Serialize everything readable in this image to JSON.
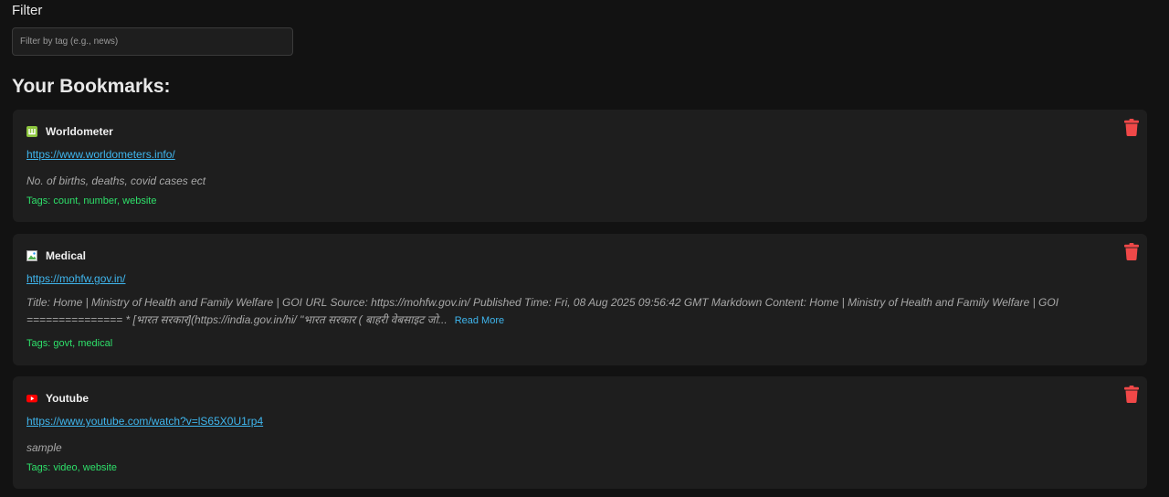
{
  "filter": {
    "label": "Filter",
    "placeholder": "Filter by tag (e.g., news)",
    "value": ""
  },
  "section_title": "Your Bookmarks:",
  "colors": {
    "background": "#121212",
    "card": "#1e1e1e",
    "link": "#3fb6ee",
    "tags": "#2ee06a",
    "delete": "#f04848"
  },
  "bookmarks": [
    {
      "icon": "worldometer-favicon",
      "title": "Worldometer",
      "url": "https://www.worldometers.info/",
      "description": "No. of births, deaths, covid cases ect",
      "read_more": "",
      "tags": "Tags: count, number, website",
      "delete_icon": "trash-icon"
    },
    {
      "icon": "broken-image-icon",
      "title": "Medical",
      "url": "https://mohfw.gov.in/",
      "description": "Title: Home | Ministry of Health and Family Welfare | GOI URL Source: https://mohfw.gov.in/ Published Time: Fri, 08 Aug 2025 09:56:42 GMT Markdown Content: Home | Ministry of Health and Family Welfare | GOI =============== * [भारत सरकार](https://india.gov.in/hi/ \"भारत सरकार ( बाहरी वेबसाइट जो...",
      "read_more": "Read More",
      "tags": "Tags: govt, medical",
      "delete_icon": "trash-icon"
    },
    {
      "icon": "youtube-favicon",
      "title": "Youtube",
      "url": "https://www.youtube.com/watch?v=lS65X0U1rp4",
      "description": "sample",
      "read_more": "",
      "tags": "Tags: video, website",
      "delete_icon": "trash-icon"
    }
  ]
}
